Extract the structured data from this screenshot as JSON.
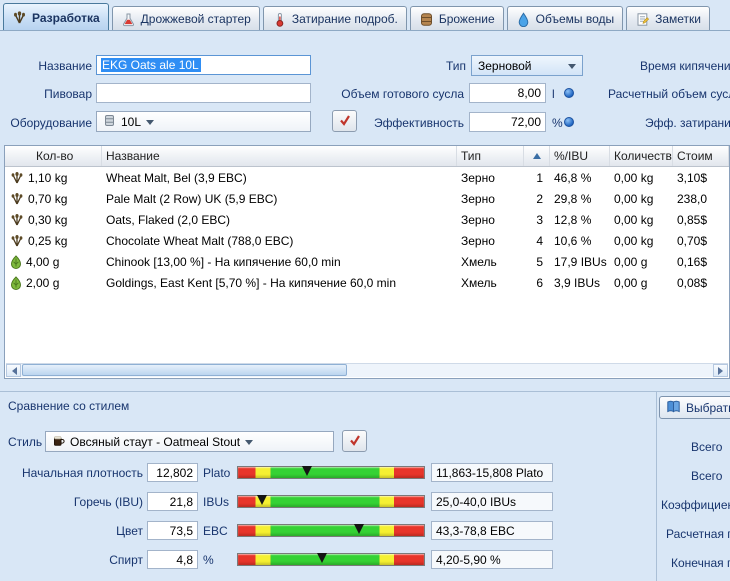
{
  "colors": {
    "label_navy": "#18356e",
    "selection_bg": "#2f8ef4",
    "tab_active_bg": "#c8def5",
    "gauge_red": "#e8352a",
    "gauge_yellow": "#f5f032",
    "gauge_green": "#35d234"
  },
  "tabs": [
    {
      "label": "Разработка",
      "icon": "recipe-design-icon",
      "active": true
    },
    {
      "label": "Дрожжевой стартер",
      "icon": "yeast-starter-icon",
      "active": false
    },
    {
      "label": "Затирание подроб.",
      "icon": "mash-detail-icon",
      "active": false
    },
    {
      "label": "Брожение",
      "icon": "fermentation-icon",
      "active": false
    },
    {
      "label": "Объемы воды",
      "icon": "water-volumes-icon",
      "active": false
    },
    {
      "label": "Заметки",
      "icon": "notes-icon",
      "active": false
    }
  ],
  "recipe_fields": {
    "name_label": "Название",
    "name_value": "EKG Oats ale 10L",
    "brewer_label": "Пивовар",
    "brewer_value": "",
    "equipment_label": "Оборудование",
    "equipment_value": "10L",
    "equipment_icon": "keg-icon",
    "type_label": "Тип",
    "type_value": "Зерновой",
    "boil_volume_label": "Объем готового сусла",
    "boil_volume_value": "8,00",
    "boil_volume_unit": "l",
    "efficiency_label": "Эффективность",
    "efficiency_value": "72,00",
    "efficiency_unit": "%",
    "right_labels": {
      "boil_time": "Время кипячения",
      "est_volume": "Расчетный объем сусла",
      "mash_eff": "Эфф. затирания"
    }
  },
  "ingredients": {
    "headers": {
      "amount": "Кол-во",
      "name": "Название",
      "type": "Тип",
      "pct": "%/IBU",
      "qty": "Количество",
      "cost": "Стоим"
    },
    "sort_ascending": true,
    "rows": [
      {
        "icon": "grain-icon",
        "amount": "1,10 kg",
        "name": "Wheat Malt, Bel (3,9 EBC)",
        "type": "Зерно",
        "num": "1",
        "pct": "46,8 %",
        "qty": "0,00 kg",
        "cost": "3,10$"
      },
      {
        "icon": "grain-icon",
        "amount": "0,70 kg",
        "name": "Pale Malt (2 Row) UK (5,9 EBC)",
        "type": "Зерно",
        "num": "2",
        "pct": "29,8 %",
        "qty": "0,00 kg",
        "cost": "238,0"
      },
      {
        "icon": "grain-icon",
        "amount": "0,30 kg",
        "name": "Oats, Flaked (2,0 EBC)",
        "type": "Зерно",
        "num": "3",
        "pct": "12,8 %",
        "qty": "0,00 kg",
        "cost": "0,85$"
      },
      {
        "icon": "grain-icon",
        "amount": "0,25 kg",
        "name": "Chocolate Wheat Malt (788,0 EBC)",
        "type": "Зерно",
        "num": "4",
        "pct": "10,6 %",
        "qty": "0,00 kg",
        "cost": "0,70$"
      },
      {
        "icon": "hop-icon",
        "amount": "4,00 g",
        "name": "Chinook [13,00 %] - На кипячение 60,0 min",
        "type": "Хмель",
        "num": "5",
        "pct": "17,9 IBUs",
        "qty": "0,00 g",
        "cost": "0,16$"
      },
      {
        "icon": "hop-icon",
        "amount": "2,00 g",
        "name": "Goldings, East Kent [5,70 %] - На кипячение 60,0 min",
        "type": "Хмель",
        "num": "6",
        "pct": "3,9 IBUs",
        "qty": "0,00 g",
        "cost": "0,08$"
      }
    ]
  },
  "style_compare": {
    "section_title": "Сравнение со стилем",
    "style_label": "Стиль",
    "style_value": "Овсяный стаут - Oatmeal Stout",
    "style_icon": "mug-icon",
    "select_button": "Выбрать",
    "segments": [
      9.5,
      17.5,
      76,
      84
    ],
    "gauges": [
      {
        "label": "Начальная плотность",
        "value": "12,802",
        "unit": "Plato",
        "range": "11,863-15,808 Plato",
        "marker_pct": 37
      },
      {
        "label": "Горечь (IBU)",
        "value": "21,8",
        "unit": "IBUs",
        "range": "25,0-40,0 IBUs",
        "marker_pct": 13
      },
      {
        "label": "Цвет",
        "value": "73,5",
        "unit": "EBC",
        "range": "43,3-78,8 EBC",
        "marker_pct": 65
      },
      {
        "label": "Спирт",
        "value": "4,8",
        "unit": "%",
        "range": "4,20-5,90 %",
        "marker_pct": 45
      }
    ],
    "right_labels": [
      "Всего",
      "Всего",
      "Коэффициент п",
      "Расчетная пло",
      "Конечная пло"
    ]
  }
}
